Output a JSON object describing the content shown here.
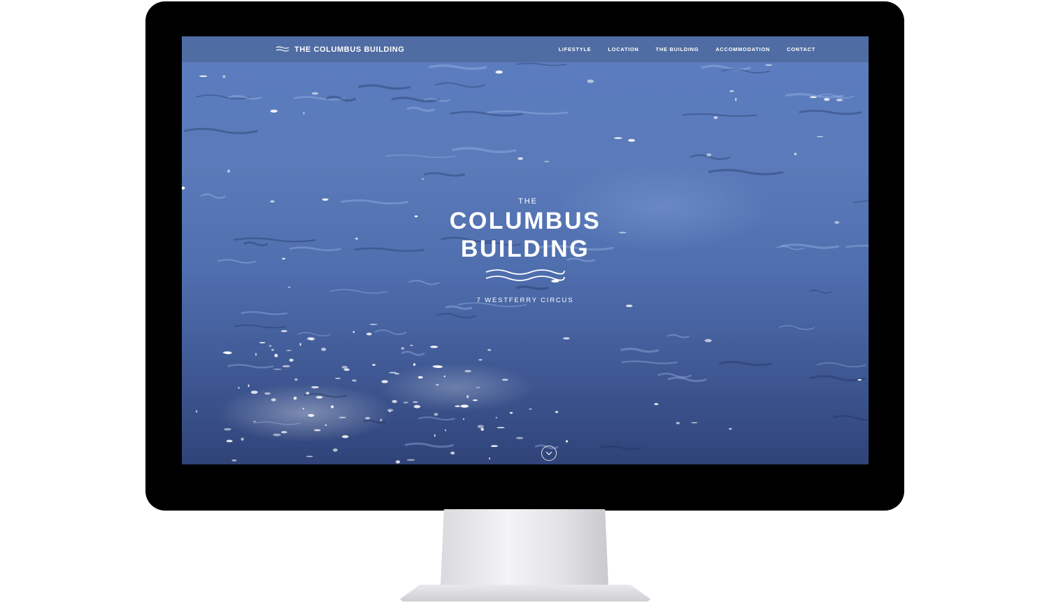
{
  "navbar": {
    "brand_icon": "waves-logo-icon",
    "brand_label": "THE COLUMBUS BUILDING",
    "items": [
      {
        "label": "LIFESTYLE"
      },
      {
        "label": "LOCATION"
      },
      {
        "label": "THE BUILDING"
      },
      {
        "label": "ACCOMMODATION"
      },
      {
        "label": "CONTACT"
      }
    ]
  },
  "hero": {
    "overline": "THE",
    "title_line1": "COLUMBUS",
    "title_line2": "BUILDING",
    "emblem_icon": "waves-emblem-icon",
    "address": "7 WESTFERRY CIRCUS"
  },
  "scroll": {
    "icon": "chevron-down-icon"
  },
  "colors": {
    "text": "#ffffff",
    "water_light": "#5b7cc0",
    "water_dark": "#2f4378",
    "monitor_frame": "#000000"
  }
}
